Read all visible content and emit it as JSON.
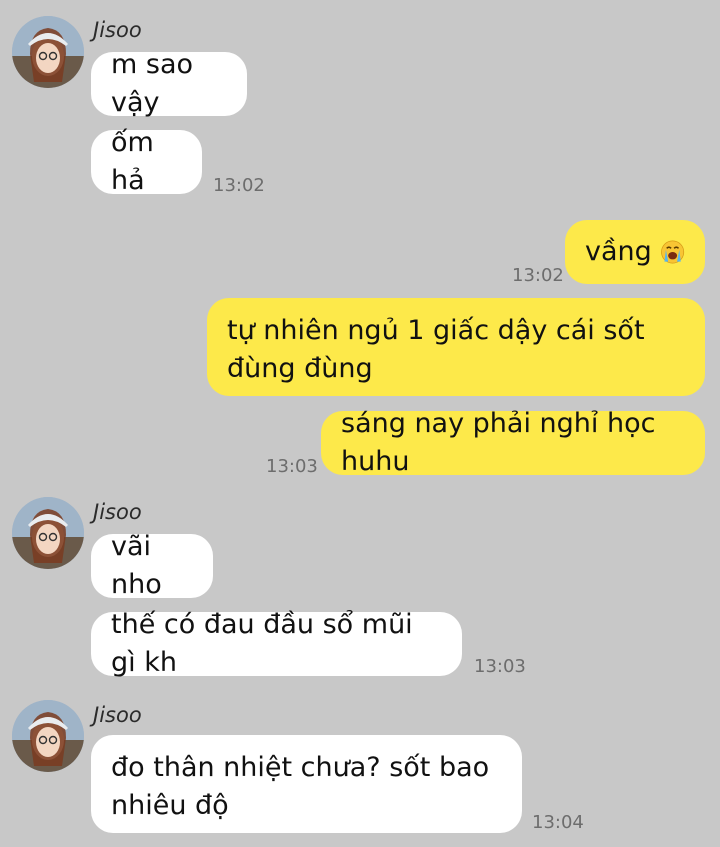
{
  "messages": [
    {
      "sender": "Jisoo",
      "text": "m sao vậy"
    },
    {
      "text": "ốm hả",
      "time": "13:02"
    },
    {
      "text": "vầng",
      "emoji": "loudly-crying-face-emoji"
    },
    {
      "time": "13:02"
    },
    {
      "text": "tự nhiên ngủ 1 giấc dậy cái sốt đùng đùng"
    },
    {
      "text": "sáng nay phải nghỉ học huhu",
      "time": "13:03"
    },
    {
      "sender": "Jisoo",
      "text": "vãi nho"
    },
    {
      "text": "thế có đau đầu sổ mũi gì kh",
      "time": "13:03"
    },
    {
      "sender": "Jisoo",
      "text": "đo thân nhiệt chưa? sốt bao nhiêu độ",
      "time": "13:04"
    }
  ],
  "colors": {
    "background": "#c8c8c8",
    "incoming_bubble": "#ffffff",
    "outgoing_bubble": "#fde94a"
  }
}
